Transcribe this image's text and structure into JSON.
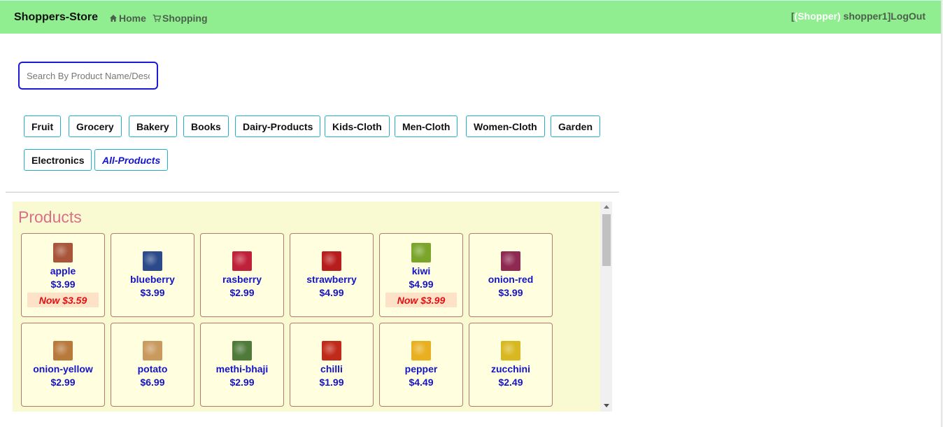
{
  "navbar": {
    "brand": "Shoppers-Store",
    "home_label": "Home",
    "shopping_label": "Shopping",
    "user_open_bracket": "[",
    "user_role": "(Shopper)",
    "user_name": " shopper1",
    "user_close_bracket": "]",
    "logout_label": "LogOut",
    "icons": {
      "home": "home-icon",
      "shopping": "cart-icon"
    }
  },
  "search": {
    "placeholder": "Search By Product Name/Desc.."
  },
  "categories": [
    "Fruit",
    "Grocery",
    "Bakery",
    "Books",
    "Dairy-Products",
    "Kids-Cloth",
    "Men-Cloth",
    "Women-Cloth",
    "Garden",
    "Electronics",
    "All-Products"
  ],
  "active_category": "All-Products",
  "products_title": "Products",
  "products": [
    {
      "name": "apple",
      "price": "$3.99",
      "sale": "Now $3.59",
      "color": "#a8553a"
    },
    {
      "name": "blueberry",
      "price": "$3.99",
      "color": "#2c4a8a"
    },
    {
      "name": "rasberry",
      "price": "$2.99",
      "color": "#c0213a"
    },
    {
      "name": "strawberry",
      "price": "$4.99",
      "color": "#b81d1d"
    },
    {
      "name": "kiwi",
      "price": "$4.99",
      "sale": "Now $3.99",
      "color": "#7aa52a"
    },
    {
      "name": "onion-red",
      "price": "$3.99",
      "color": "#8e2a52"
    },
    {
      "name": "onion-yellow",
      "price": "$2.99",
      "color": "#b87a3c"
    },
    {
      "name": "potato",
      "price": "$6.99",
      "color": "#c89a5e"
    },
    {
      "name": "methi-bhaji",
      "price": "$2.99",
      "color": "#4e7a3a"
    },
    {
      "name": "chilli",
      "price": "$1.99",
      "color": "#c02a1a"
    },
    {
      "name": "pepper",
      "price": "$4.49",
      "color": "#e8b020"
    },
    {
      "name": "zucchini",
      "price": "$2.49",
      "color": "#d8b820"
    }
  ],
  "colors": {
    "navbar": "#90ee90",
    "accent_blue": "#1414c8",
    "sale_red": "#e01010",
    "panel_bg": "#fafad2",
    "title_pink": "#d9708a"
  }
}
